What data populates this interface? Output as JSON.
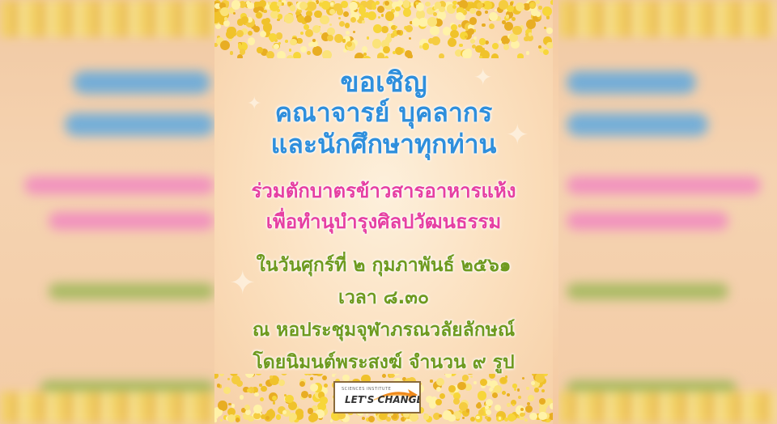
{
  "invitation": {
    "line1": "ขอเชิญ",
    "line2": "คณาจารย์ บุคลากร",
    "line3": "และนักศึกษาทุกท่าน"
  },
  "event": {
    "line1": "ร่วมตักบาตรข้าวสารอาหารแห้ง",
    "line2": "เพื่อทำนุบำรุงศิลปวัฒนธรรม"
  },
  "details": {
    "date": "ในวันศุกร์ที่ ๒ กุมภาพันธ์ ๒๕๖๑",
    "time": "เวลา ๘.๓๐",
    "place": "ณ หอประชุมจุฬาภรณวลัยลักษณ์",
    "monks": "โดยนิมนต์พระสงฆ์ จำนวน ๙ รูป"
  },
  "logo": {
    "small_text": "SCIENCES INSTITUTE",
    "main_text": "LET'S CHANGE"
  },
  "colors": {
    "blue": "#2f8fdc",
    "magenta": "#e63fa2",
    "green": "#6e9a1f",
    "gold": "#f3cf3a",
    "background": "#fbdfbd"
  },
  "icons": [
    "star-sparkle-icon",
    "arrow-swoosh-icon"
  ]
}
